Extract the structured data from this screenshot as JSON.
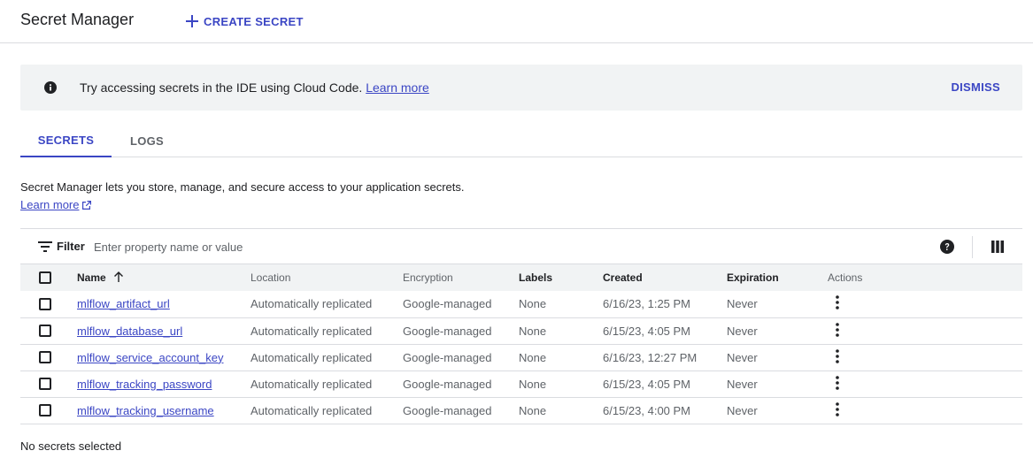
{
  "header": {
    "title": "Secret Manager",
    "create_label": "CREATE SECRET"
  },
  "banner": {
    "message": "Try accessing secrets in the IDE using Cloud Code.",
    "link": "Learn more",
    "dismiss": "DISMISS"
  },
  "tabs": [
    {
      "label": "SECRETS",
      "active": true
    },
    {
      "label": "LOGS",
      "active": false
    }
  ],
  "description": {
    "text": "Secret Manager lets you store, manage, and secure access to your application secrets.",
    "link": "Learn more"
  },
  "filter": {
    "label": "Filter",
    "placeholder": "Enter property name or value"
  },
  "table": {
    "columns": [
      "Name",
      "Location",
      "Encryption",
      "Labels",
      "Created",
      "Expiration",
      "Actions"
    ],
    "rows": [
      {
        "name": "mlflow_artifact_url",
        "location": "Automatically replicated",
        "encryption": "Google-managed",
        "labels": "None",
        "created": "6/16/23, 1:25 PM",
        "expiration": "Never"
      },
      {
        "name": "mlflow_database_url",
        "location": "Automatically replicated",
        "encryption": "Google-managed",
        "labels": "None",
        "created": "6/15/23, 4:05 PM",
        "expiration": "Never"
      },
      {
        "name": "mlflow_service_account_key",
        "location": "Automatically replicated",
        "encryption": "Google-managed",
        "labels": "None",
        "created": "6/16/23, 12:27 PM",
        "expiration": "Never"
      },
      {
        "name": "mlflow_tracking_password",
        "location": "Automatically replicated",
        "encryption": "Google-managed",
        "labels": "None",
        "created": "6/15/23, 4:05 PM",
        "expiration": "Never"
      },
      {
        "name": "mlflow_tracking_username",
        "location": "Automatically replicated",
        "encryption": "Google-managed",
        "labels": "None",
        "created": "6/15/23, 4:00 PM",
        "expiration": "Never"
      }
    ]
  },
  "status": "No secrets selected",
  "colors": {
    "accent": "#3b46c4",
    "banner_bg": "#f1f3f4",
    "divider": "#dadce0"
  }
}
